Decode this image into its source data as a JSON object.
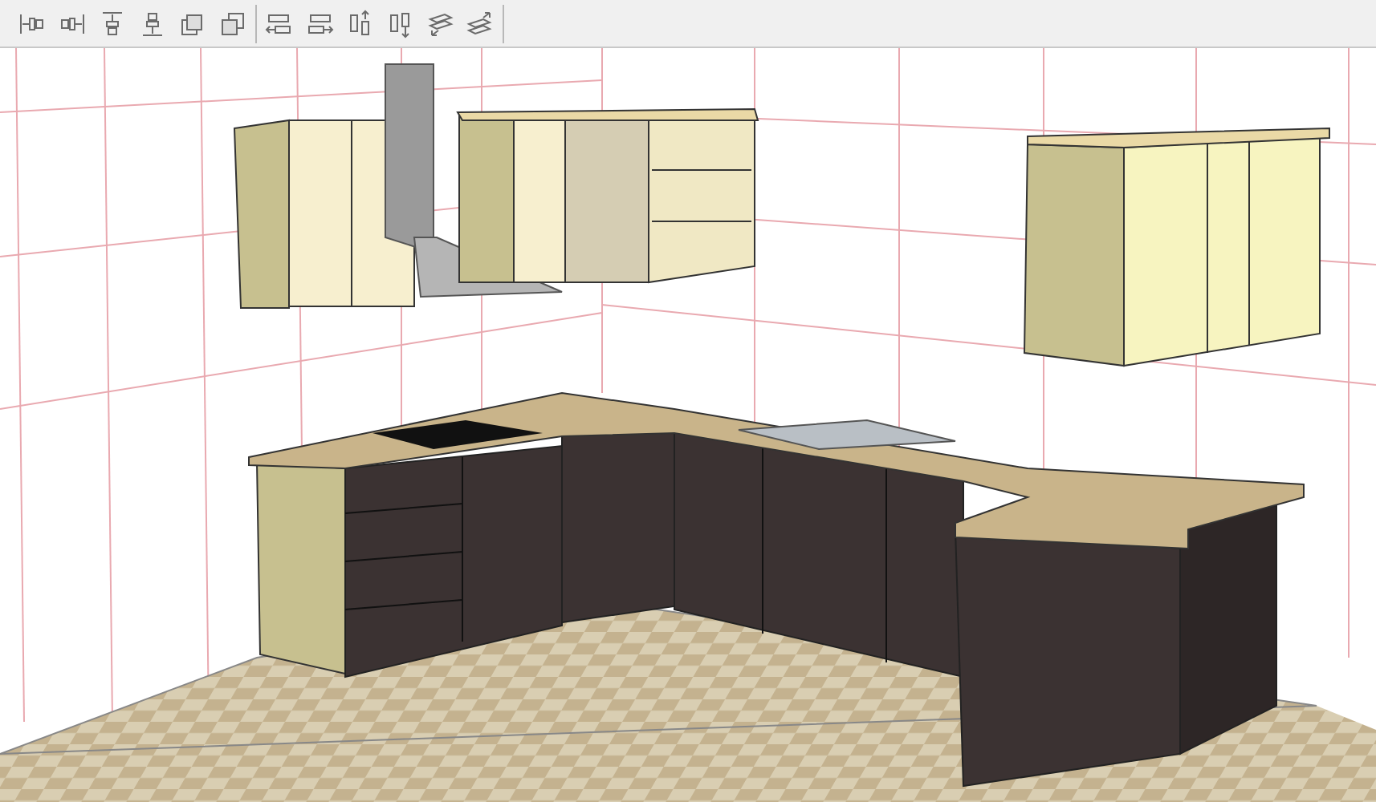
{
  "toolbar": {
    "groups": [
      {
        "buttons": [
          {
            "kind": "align-left"
          },
          {
            "kind": "align-right"
          },
          {
            "kind": "align-top"
          },
          {
            "kind": "align-bottom"
          },
          {
            "kind": "bring-front"
          },
          {
            "kind": "send-back"
          }
        ]
      },
      {
        "buttons": [
          {
            "kind": "move-left"
          },
          {
            "kind": "move-right"
          },
          {
            "kind": "move-up"
          },
          {
            "kind": "move-down"
          },
          {
            "kind": "rotate-cw"
          },
          {
            "kind": "rotate-ccw"
          }
        ]
      }
    ]
  }
}
